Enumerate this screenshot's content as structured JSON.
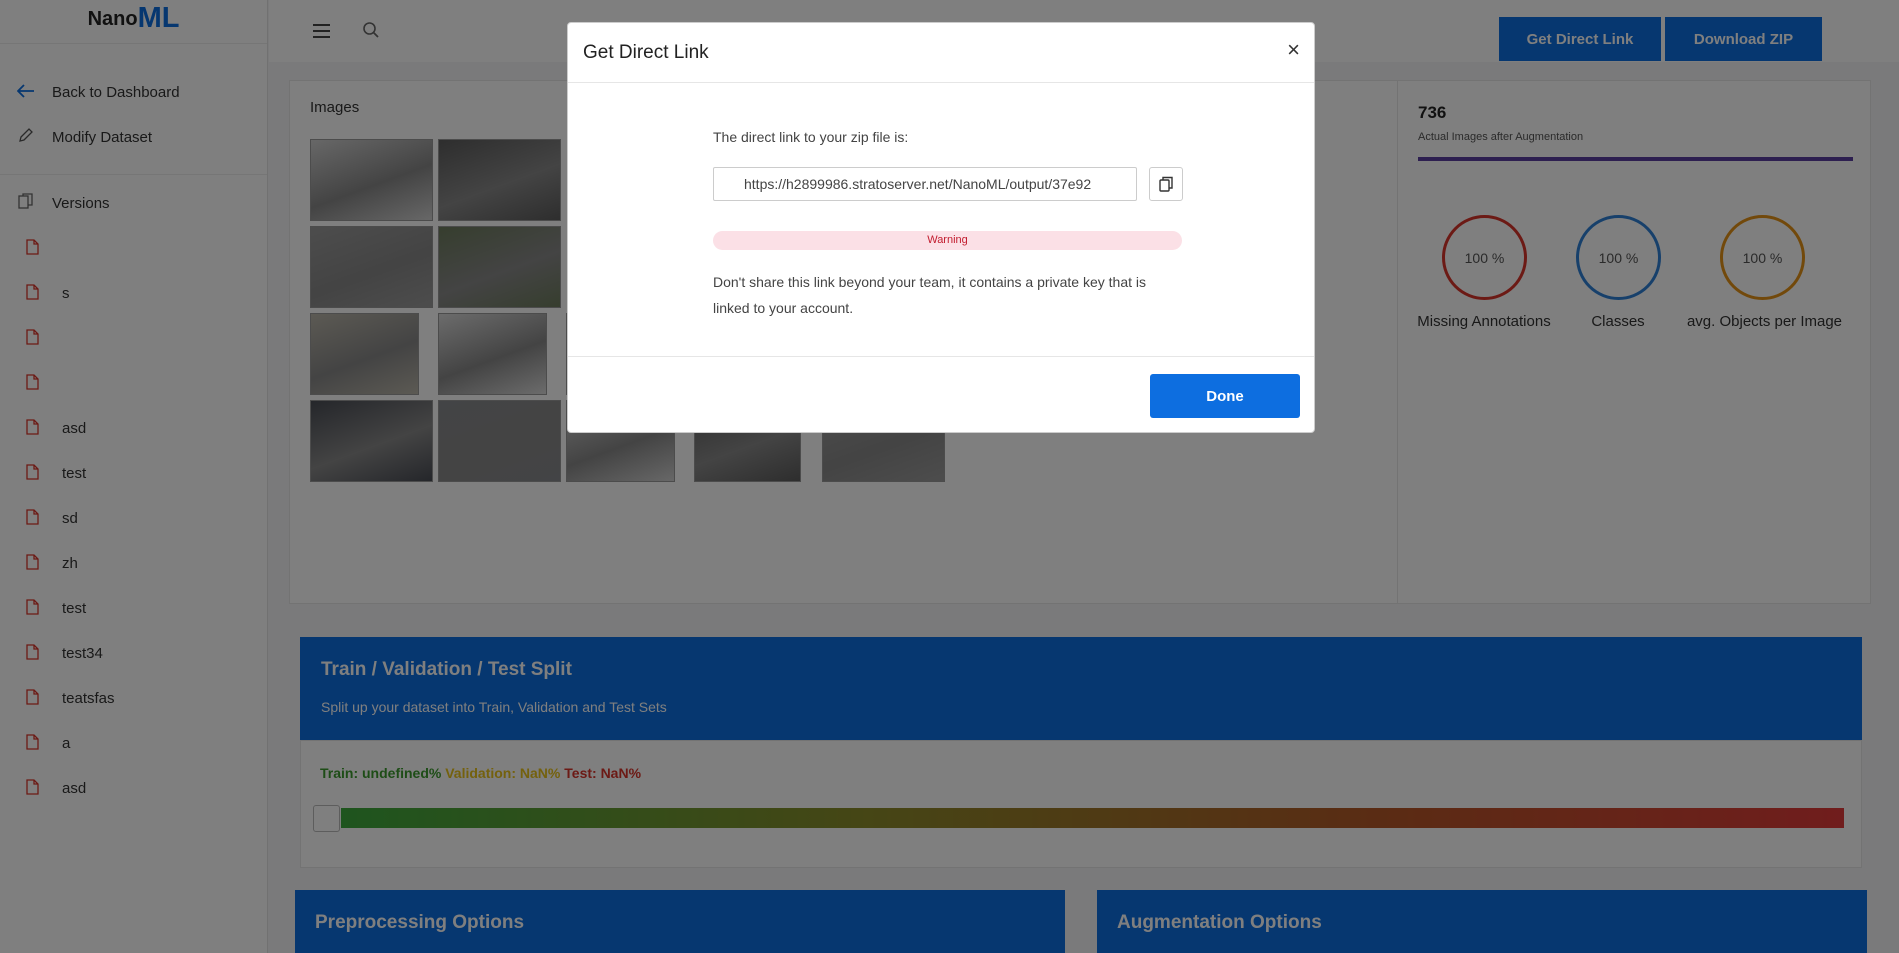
{
  "brand": {
    "nano": "Nano",
    "ml": "ML"
  },
  "sidebar": {
    "back_label": "Back to Dashboard",
    "modify_label": "Modify Dataset",
    "versions_label": "Versions",
    "versions": [
      "",
      "s",
      "",
      "",
      "asd",
      "test",
      "sd",
      "zh",
      "test",
      "test34",
      "teatsfas",
      "a",
      "asd"
    ]
  },
  "topbar": {
    "direct_link_label": "Get Direct Link",
    "download_label": "Download ZIP"
  },
  "images": {
    "title": "Images"
  },
  "stats": {
    "count": "736",
    "count_label": "Actual Images after Augmentation",
    "rings": [
      {
        "value": "100 %",
        "label": "Missing Annotations",
        "color": "#d9342b"
      },
      {
        "value": "100 %",
        "label": "Classes",
        "color": "#2f80d6"
      },
      {
        "value": "100 %",
        "label": "avg. Objects per Image",
        "color": "#e59216"
      }
    ]
  },
  "split": {
    "title": "Train / Validation / Test Split",
    "subtitle": "Split up your dataset into Train, Validation and Test Sets",
    "train": "Train: undefined%",
    "validation": "Validation: NaN%",
    "test": "Test: NaN%"
  },
  "options": {
    "preprocessing": "Preprocessing Options",
    "augmentation": "Augmentation Options"
  },
  "modal": {
    "title": "Get Direct Link",
    "close": "×",
    "intro": "The direct link to your zip file is:",
    "link": "https://h2899986.stratoserver.net/NanoML/output/37e92",
    "warning_badge": "Warning",
    "warning_text": "Don't share this link beyond your team, it contains a private key that is linked to your account.",
    "done": "Done"
  },
  "colors": {
    "accent": "#0d6ee0",
    "train": "#3daa3d",
    "validation": "#e8c21a",
    "test": "#e13a3a"
  }
}
